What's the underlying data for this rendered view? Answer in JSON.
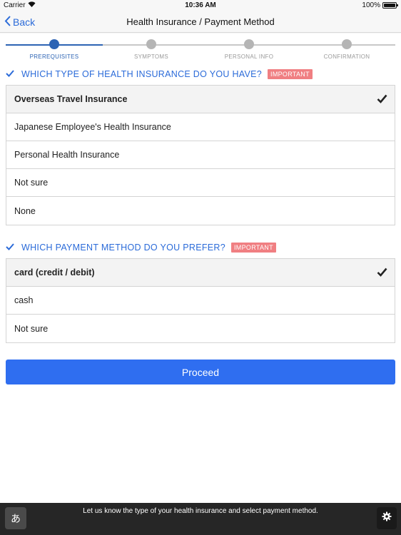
{
  "status": {
    "carrier": "Carrier",
    "time": "10:36 AM",
    "battery": "100%"
  },
  "nav": {
    "back_label": "Back",
    "title": "Health Insurance / Payment Method"
  },
  "steps": [
    {
      "label": "PREREQUISITES",
      "active": true
    },
    {
      "label": "SYMPTOMS",
      "active": false
    },
    {
      "label": "PERSONAL INFO",
      "active": false
    },
    {
      "label": "CONFIRMATION",
      "active": false
    }
  ],
  "insurance": {
    "question": "WHICH TYPE OF HEALTH INSURANCE DO YOU HAVE?",
    "badge": "IMPORTANT",
    "options": [
      {
        "label": "Overseas Travel Insurance",
        "selected": true
      },
      {
        "label": "Japanese Employee's Health Insurance",
        "selected": false
      },
      {
        "label": "Personal Health Insurance",
        "selected": false
      },
      {
        "label": "Not sure",
        "selected": false
      },
      {
        "label": "None",
        "selected": false
      }
    ]
  },
  "payment": {
    "question": "WHICH PAYMENT METHOD DO YOU PREFER?",
    "badge": "IMPORTANT",
    "options": [
      {
        "label": "card (credit / debit)",
        "selected": true
      },
      {
        "label": "cash",
        "selected": false
      },
      {
        "label": "Not sure",
        "selected": false
      }
    ]
  },
  "proceed_label": "Proceed",
  "bottom": {
    "message": "Let us know the type of your health insurance and select payment method.",
    "kana_button": "あ"
  },
  "colors": {
    "accent": "#2b6bd9",
    "step_active": "#2d64b4",
    "badge": "#f07f82",
    "proceed": "#2f6ef0",
    "bottom_bar": "#262626"
  }
}
